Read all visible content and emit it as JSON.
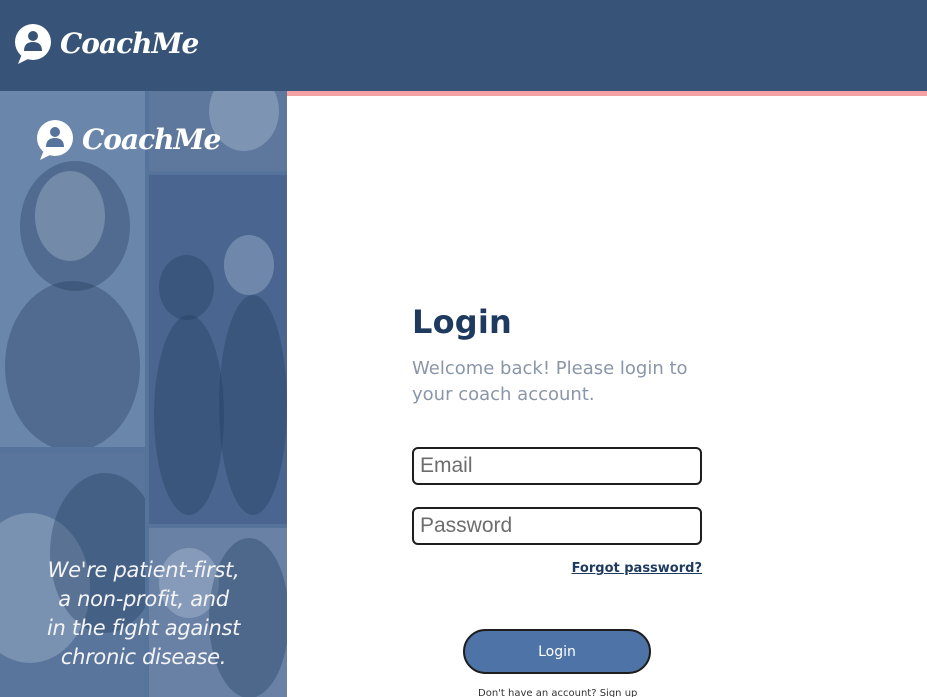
{
  "header": {
    "brand": "CoachMe"
  },
  "side_panel": {
    "brand": "CoachMe",
    "tagline": [
      "We're patient-first,",
      "a non-profit, and",
      "in the fight against",
      "chronic disease."
    ]
  },
  "login": {
    "title": "Login",
    "subtitle": "Welcome back! Please login to your coach account.",
    "email_placeholder": "Email",
    "email_value": "",
    "password_placeholder": "Password",
    "password_value": "",
    "forgot_label": "Forgot password?",
    "button_label": "Login",
    "signup_prompt": "Don't have an account?",
    "signup_link": "Sign up"
  },
  "colors": {
    "header_bg": "#375478",
    "accent_bar": "#f4a1a3",
    "title": "#1f3a5f",
    "subtitle": "#8a96a8",
    "button_bg": "#4e74a7"
  },
  "icons": {
    "logo": "person-speech-bubble-icon"
  }
}
